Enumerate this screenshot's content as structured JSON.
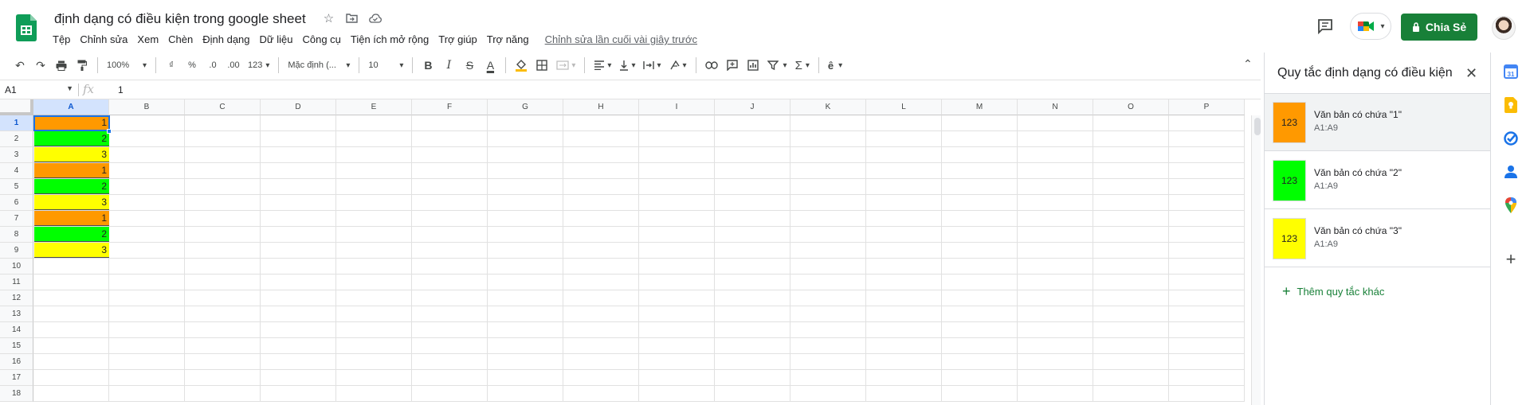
{
  "doc": {
    "title": "định dạng có điều kiện trong google sheet",
    "icons": [
      "star-icon",
      "move-to-folder-icon",
      "cloud-saved-icon"
    ]
  },
  "menu": {
    "items": [
      "Tệp",
      "Chỉnh sửa",
      "Xem",
      "Chèn",
      "Định dạng",
      "Dữ liệu",
      "Công cụ",
      "Tiện ích mở rộng",
      "Trợ giúp",
      "Trợ năng"
    ],
    "last_edit": "Chỉnh sửa lần cuối vài giây trước"
  },
  "header": {
    "share_label": "Chia Sẻ",
    "colors": {
      "share_bg": "#188038",
      "sheets_green": "#0f9d58"
    }
  },
  "toolbar": {
    "zoom": "100%",
    "currency": "₫",
    "percent": "%",
    "dec_decrease": ".0",
    "dec_increase": ".00",
    "number_format": "123",
    "font": "Mặc định (...",
    "font_size": "10",
    "bold": "B",
    "italic": "I",
    "strike": "S",
    "text_color": "A"
  },
  "formula_bar": {
    "name_box": "A1",
    "fx": "fx",
    "value": "1"
  },
  "grid": {
    "columns": [
      "A",
      "B",
      "C",
      "D",
      "E",
      "F",
      "G",
      "H",
      "I",
      "J",
      "K",
      "L",
      "M",
      "N",
      "O",
      "P"
    ],
    "rows": [
      "1",
      "2",
      "3",
      "4",
      "5",
      "6",
      "7",
      "8",
      "9",
      "10",
      "11",
      "12",
      "13",
      "14",
      "15",
      "16",
      "17",
      "18"
    ],
    "cells_A": [
      "1",
      "2",
      "3",
      "1",
      "2",
      "3",
      "1",
      "2",
      "3"
    ],
    "colors": {
      "1": "#ff9900",
      "2": "#00ff00",
      "3": "#ffff00"
    }
  },
  "panel": {
    "title": "Quy tắc định dạng có điều kiện",
    "rules": [
      {
        "swatch_text": "123",
        "text": "Văn bản có chứa \"1\"",
        "range": "A1:A9",
        "color": "#ff9900"
      },
      {
        "swatch_text": "123",
        "text": "Văn bản có chứa \"2\"",
        "range": "A1:A9",
        "color": "#00ff00"
      },
      {
        "swatch_text": "123",
        "text": "Văn bản có chứa \"3\"",
        "range": "A1:A9",
        "color": "#ffff00"
      }
    ],
    "add_rule": "Thêm quy tắc khác"
  },
  "rail": {
    "calendar_day": "31",
    "icons": [
      "calendar-icon",
      "keep-icon",
      "tasks-icon",
      "contacts-icon",
      "maps-icon",
      "add-icon"
    ]
  }
}
